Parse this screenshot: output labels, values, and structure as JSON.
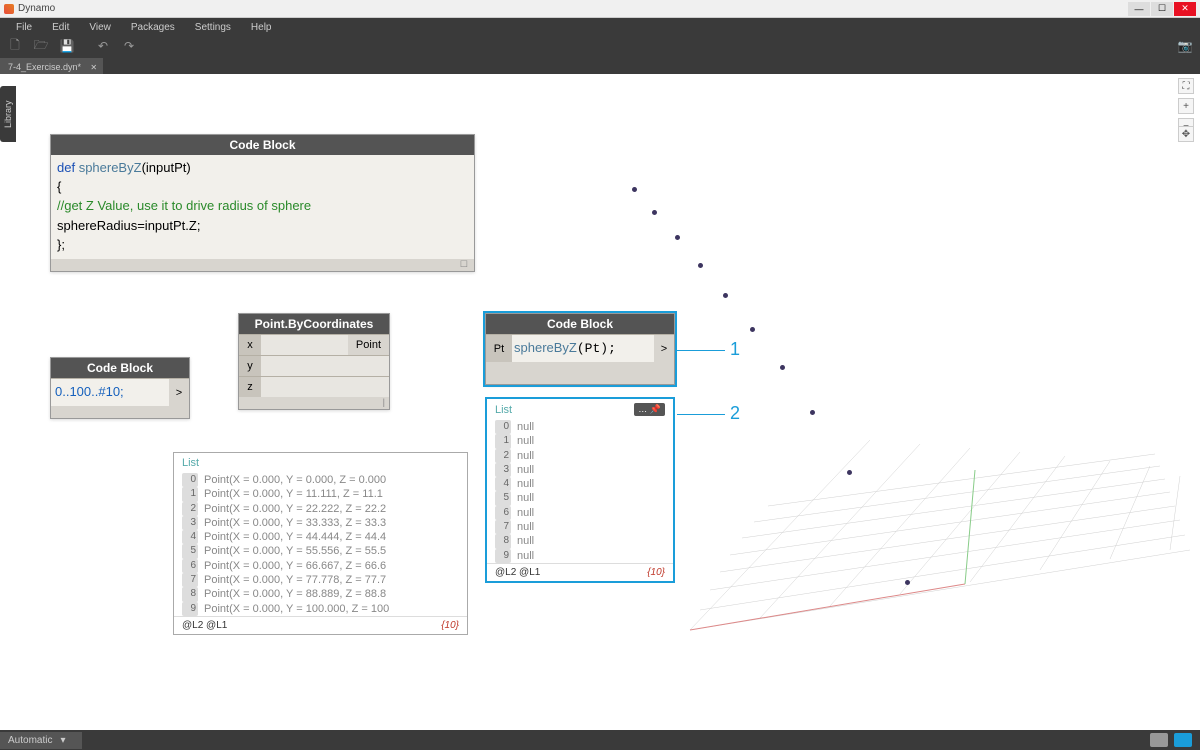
{
  "app": {
    "title": "Dynamo"
  },
  "menu": [
    "File",
    "Edit",
    "View",
    "Packages",
    "Settings",
    "Help"
  ],
  "tab": {
    "name": "7-4_Exercise.dyn*"
  },
  "library_label": "Library",
  "nodes": {
    "cb_def": {
      "title": "Code Block",
      "lines": [
        {
          "t": "def ",
          "c": "kw"
        },
        {
          "t": "sphereByZ",
          "c": "fn"
        },
        {
          "t": "(inputPt)"
        },
        {
          "br": true
        },
        {
          "t": "{"
        },
        {
          "br": true
        },
        {
          "t": "//get Z Value, use it to drive radius of sphere",
          "c": "cmt"
        },
        {
          "br": true
        },
        {
          "t": "sphereRadius=inputPt.Z;"
        },
        {
          "br": true
        },
        {
          "t": "};"
        }
      ]
    },
    "cb_range": {
      "title": "Code Block",
      "code": "0..100..#10;",
      "out": ">"
    },
    "pbc": {
      "title": "Point.ByCoordinates",
      "inputs": [
        "x",
        "y",
        "z"
      ],
      "output": "Point"
    },
    "cb_call": {
      "title": "Code Block",
      "in": "Pt",
      "code": "sphereByZ(Pt);",
      "out": ">"
    }
  },
  "preview_points": {
    "header": "List",
    "rows": [
      {
        "i": 0,
        "t": "Point(X = 0.000, Y = 0.000, Z = 0.000"
      },
      {
        "i": 1,
        "t": "Point(X = 0.000, Y = 11.111, Z = 11.1"
      },
      {
        "i": 2,
        "t": "Point(X = 0.000, Y = 22.222, Z = 22.2"
      },
      {
        "i": 3,
        "t": "Point(X = 0.000, Y = 33.333, Z = 33.3"
      },
      {
        "i": 4,
        "t": "Point(X = 0.000, Y = 44.444, Z = 44.4"
      },
      {
        "i": 5,
        "t": "Point(X = 0.000, Y = 55.556, Z = 55.5"
      },
      {
        "i": 6,
        "t": "Point(X = 0.000, Y = 66.667, Z = 66.6"
      },
      {
        "i": 7,
        "t": "Point(X = 0.000, Y = 77.778, Z = 77.7"
      },
      {
        "i": 8,
        "t": "Point(X = 0.000, Y = 88.889, Z = 88.8"
      },
      {
        "i": 9,
        "t": "Point(X = 0.000, Y = 100.000, Z = 100"
      }
    ],
    "levels": "@L2 @L1",
    "count": "{10}"
  },
  "preview_nulls": {
    "header": "List",
    "rows": [
      {
        "i": 0,
        "t": "null"
      },
      {
        "i": 1,
        "t": "null"
      },
      {
        "i": 2,
        "t": "null"
      },
      {
        "i": 3,
        "t": "null"
      },
      {
        "i": 4,
        "t": "null"
      },
      {
        "i": 5,
        "t": "null"
      },
      {
        "i": 6,
        "t": "null"
      },
      {
        "i": 7,
        "t": "null"
      },
      {
        "i": 8,
        "t": "null"
      },
      {
        "i": 9,
        "t": "null"
      }
    ],
    "levels": "@L2 @L1",
    "count": "{10}"
  },
  "annotations": {
    "one": "1",
    "two": "2"
  },
  "statusbar": {
    "mode": "Automatic"
  }
}
